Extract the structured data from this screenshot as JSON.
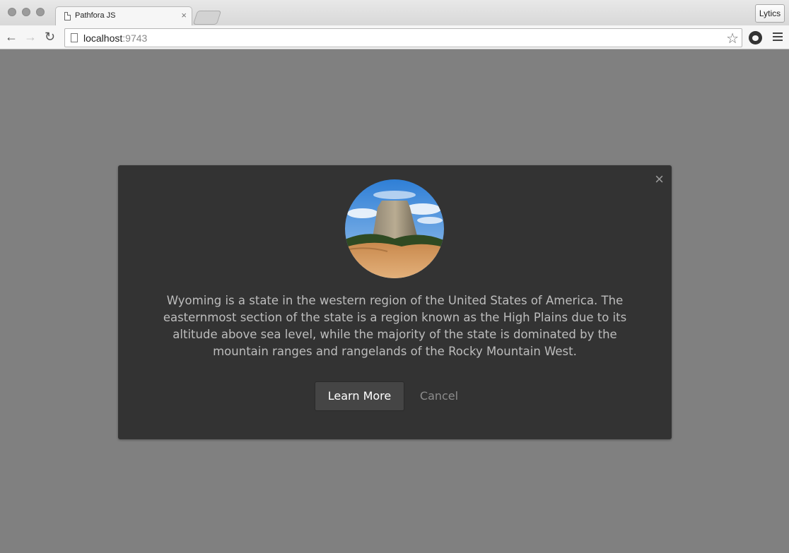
{
  "browser": {
    "tab_title": "Pathfora JS",
    "tab_close": "×",
    "profile_label": "Lytics",
    "url_host": "localhost",
    "url_port": ":9743",
    "back_glyph": "←",
    "forward_glyph": "→",
    "reload_glyph": "↻",
    "star_glyph": "☆"
  },
  "modal": {
    "close_glyph": "×",
    "image_icon": "devils-tower-photo",
    "message": "Wyoming is a state in the western region of the United States of America. The easternmost section of the state is a region known as the High Plains due to its altitude above sea level, while the majority of the state is dominated by the mountain ranges and rangelands of the Rocky Mountain West.",
    "confirm_label": "Learn More",
    "cancel_label": "Cancel"
  },
  "colors": {
    "overlay": "#808080",
    "modal_bg": "#333333",
    "message_text": "#bdbdbd",
    "confirm_bg": "#454545",
    "cancel_text": "#8c8c8c"
  }
}
